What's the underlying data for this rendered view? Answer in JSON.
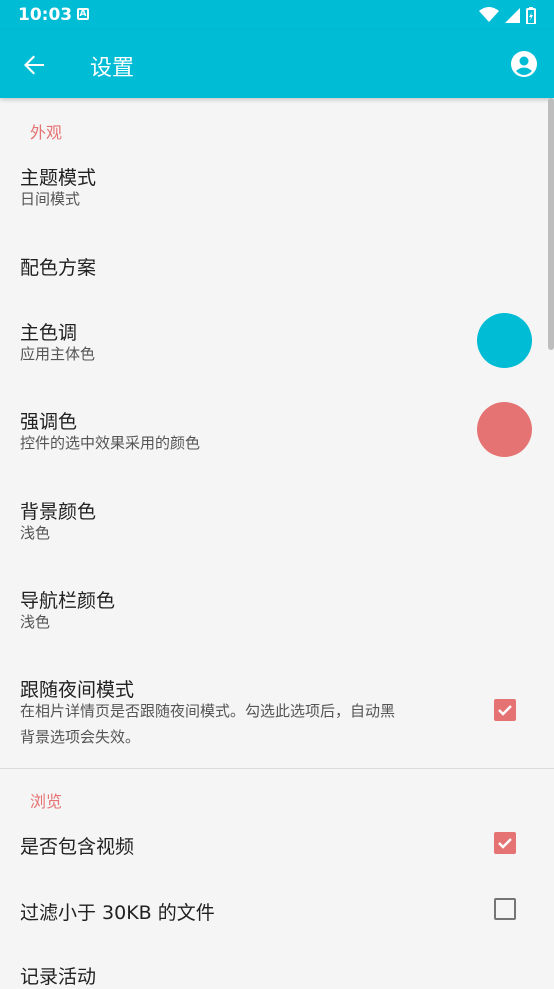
{
  "status": {
    "time": "10:03",
    "notif_icon": "A"
  },
  "appbar": {
    "title": "设置"
  },
  "colors": {
    "primary": "#00bcd4",
    "accent": "#e57373"
  },
  "sections": {
    "appearance": {
      "header": "外观",
      "theme_mode": {
        "title": "主题模式",
        "summary": "日间模式"
      },
      "color_scheme": {
        "title": "配色方案"
      },
      "primary_color": {
        "title": "主色调",
        "summary": "应用主体色",
        "color": "#00bcd4"
      },
      "accent_color": {
        "title": "强调色",
        "summary": "控件的选中效果采用的颜色",
        "color": "#e57373"
      },
      "background_color": {
        "title": "背景颜色",
        "summary": "浅色"
      },
      "navbar_color": {
        "title": "导航栏颜色",
        "summary": "浅色"
      },
      "follow_night": {
        "title": "跟随夜间模式",
        "summary_line1": "在相片详情页是否跟随夜间模式。勾选此选项后，自动黑",
        "summary_line2": "背景选项会失效。",
        "checked": true
      }
    },
    "browse": {
      "header": "浏览",
      "include_video": {
        "title": "是否包含视频",
        "checked": true
      },
      "filter_small": {
        "title": "过滤小于 30KB 的文件",
        "checked": false
      },
      "record_activity": {
        "title": "记录活动"
      }
    }
  }
}
